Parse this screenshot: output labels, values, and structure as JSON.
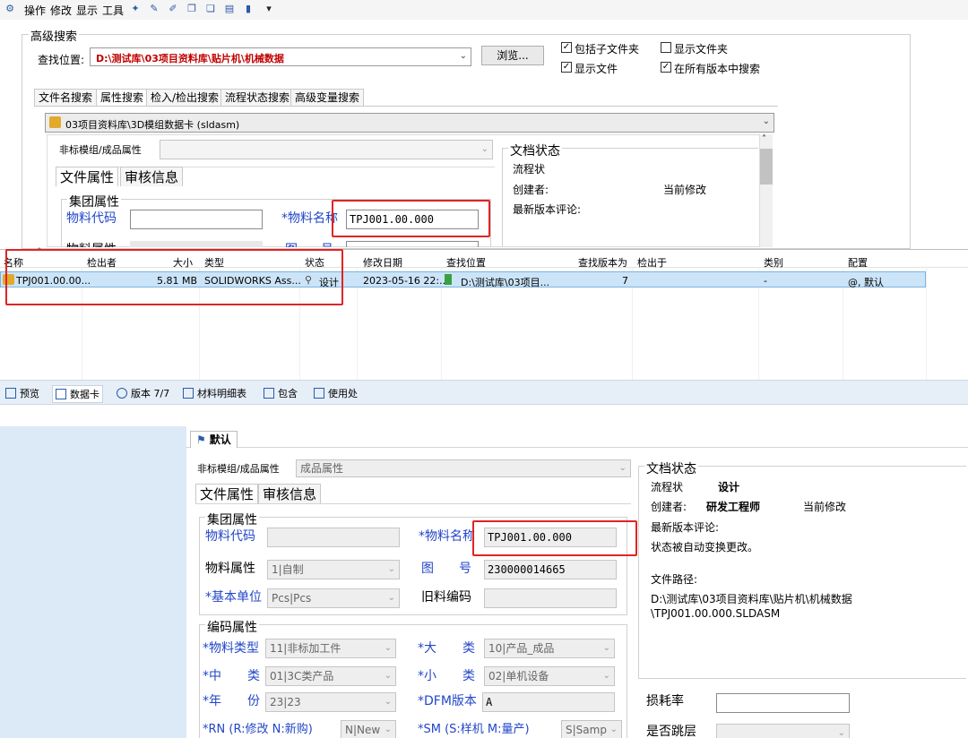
{
  "toolbar": {
    "menu": [
      "操作",
      "修改",
      "显示",
      "工具"
    ]
  },
  "search": {
    "title": "高级搜索",
    "location_label": "查找位置:",
    "location_value": "D:\\测试库\\03项目资料库\\贴片机\\机械数据",
    "browse_label": "浏览...",
    "options": [
      {
        "label": "包括子文件夹",
        "checked": true
      },
      {
        "label": "显示文件夹",
        "checked": false
      },
      {
        "label": "显示文件",
        "checked": true
      },
      {
        "label": "在所有版本中搜索",
        "checked": true
      }
    ],
    "tabs": [
      "文件名搜索",
      "属性搜索",
      "检入/检出搜索",
      "流程状态搜索",
      "高级变量搜索"
    ],
    "card_value": "03项目资料库\\3D模组数据卡 (sldasm)"
  },
  "top_card": {
    "group_label": "非标模组/成品属性",
    "tabs": [
      "文件属性",
      "审核信息"
    ],
    "section": "集团属性",
    "material_code": "物料代码",
    "material_name": "*物料名称",
    "material_name_value": "TPJ001.00.000",
    "partial_a": "物料属性",
    "partial_b": "图",
    "partial_c": "号",
    "doc_state": {
      "title": "文档状态",
      "flow": "流程状",
      "creator": "创建者:",
      "current": "当前修改",
      "comment": "最新版本评论:"
    }
  },
  "results": {
    "columns": [
      "名称",
      "检出者",
      "大小",
      "类型",
      "状态",
      "修改日期",
      "查找位置",
      "查找版本为",
      "检出于",
      "类别",
      "配置"
    ],
    "rows": [
      {
        "name": "TPJ001.00.00...",
        "checked_out_by": "",
        "size": "5.81 MB",
        "type": "SOLIDWORKS Ass...",
        "status": "设计",
        "modified": "2023-05-16 22:...",
        "location": "D:\\测试库\\03项目...",
        "version": "7",
        "checked_out_at": "",
        "category": "-",
        "config": "@, 默认"
      }
    ]
  },
  "bottom_tabs": [
    "预览",
    "数据卡",
    "版本 7/7",
    "材料明细表",
    "包含",
    "使用处"
  ],
  "datacard": {
    "config_tab": "默认",
    "group_label": "非标模组/成品属性",
    "group_value": "成品属性",
    "tabs": [
      "文件属性",
      "审核信息"
    ],
    "section1": "集团属性",
    "material_code_label": "物料代码",
    "material_code_value": "",
    "material_name_label": "*物料名称",
    "material_name_value": "TPJ001.00.000",
    "material_attr_label": "物料属性",
    "material_attr_value": "1|自制",
    "drawing_no_label_a": "图",
    "drawing_no_label_b": "号",
    "drawing_no_value": "230000014665",
    "unit_label": "*基本单位",
    "unit_value": "Pcs|Pcs",
    "old_code_label": "旧料编码",
    "old_code_value": "",
    "section2": "编码属性",
    "mat_type_label": "*物料类型",
    "mat_type_value": "11|非标加工件",
    "big_label_a": "*大",
    "big_label_b": "类",
    "big_value": "10|产品_成品",
    "mid_label_a": "*中",
    "mid_label_b": "类",
    "mid_value": "01|3C类产品",
    "small_label_a": "*小",
    "small_label_b": "类",
    "small_value": "02|单机设备",
    "year_label_a": "*年",
    "year_label_b": "份",
    "year_value": "23|23",
    "dfm_label": "*DFM版本",
    "dfm_value": "A",
    "rn_label": "*RN (R:修改 N:新购)",
    "rn_value": "N|New",
    "sm_label": "*SM (S:样机 M:量产)",
    "sm_value": "S|Samp",
    "doc_state": {
      "title": "文档状态",
      "flow_label": "流程状",
      "flow_value": "设计",
      "creator_label": "创建者:",
      "creator_value": "研发工程师",
      "current": "当前修改",
      "comment_label": "最新版本评论:",
      "comment_value": "状态被自动变换更改。",
      "path_label": "文件路径:",
      "path_line1": "D:\\测试库\\03项目资料库\\贴片机\\机械数据",
      "path_line2": "\\TPJ001.00.000.SLDASM"
    },
    "loss_label": "损耗率",
    "layer_label": "是否跳层"
  }
}
